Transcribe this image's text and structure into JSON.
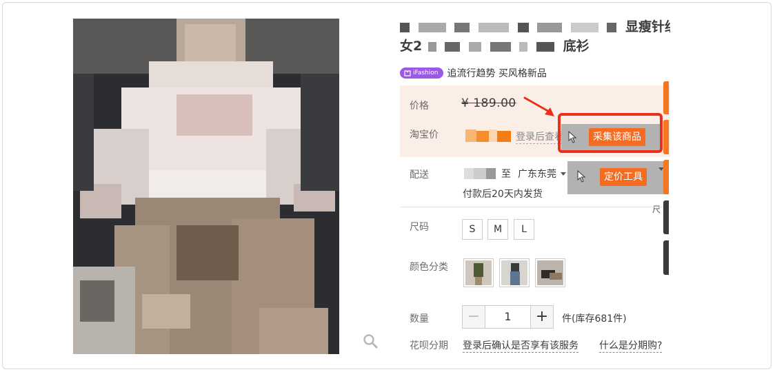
{
  "product": {
    "title_line1_suffix": "显瘦针织衫",
    "title_line2_prefix": "女2",
    "title_line2_suffix": "底衫",
    "tag_badge": "iFashion",
    "tag_text": "追流行趋势 买风格新品"
  },
  "price": {
    "label": "价格",
    "currency": "¥",
    "original": "189.00",
    "taobao_label": "淘宝价",
    "login_hint": "登录后查看是否"
  },
  "plugin": {
    "collect_label": "采集该商品",
    "pricing_label": "定价工具"
  },
  "shipping": {
    "label": "配送",
    "to": "至",
    "destination": "广东东莞",
    "delivery_time": "付款后20天内发货",
    "cut_text": "尺"
  },
  "size": {
    "label": "尺码",
    "options": [
      "S",
      "M",
      "L"
    ]
  },
  "color": {
    "label": "颜色分类",
    "thumb_names": [
      "thumb-olive-top",
      "thumb-jeans",
      "thumb-sitting"
    ]
  },
  "quantity": {
    "label": "数量",
    "value": "1",
    "minus": "−",
    "plus": "+",
    "stock": "件(库存681件)"
  },
  "installment": {
    "label": "花呗分期",
    "login_link": "登录后确认是否享有该服务",
    "what_link": "什么是分期购?"
  },
  "colors": {
    "accent_orange": "#f36c21",
    "highlight_red": "#e8301b",
    "ifashion_purple": "#9b59e4",
    "price_bg": "#fbeee6"
  }
}
